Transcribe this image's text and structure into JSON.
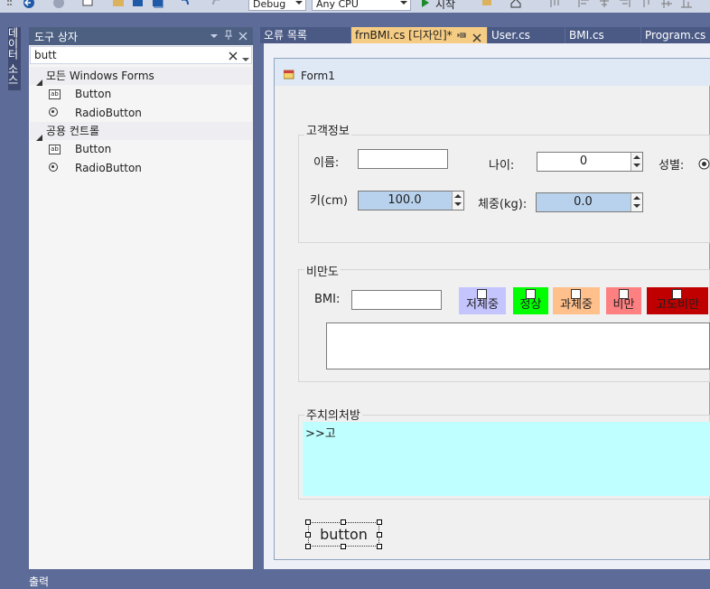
{
  "toolbar": {
    "config_value": "Debug",
    "platform_value": "Any CPU",
    "start_label": "시작"
  },
  "side_strip": {
    "data_source_label": "데이터 소스"
  },
  "toolbox": {
    "title": "도구 상자",
    "search_value": "butt",
    "groups": [
      {
        "label": "모든 Windows Forms",
        "items": [
          {
            "label": "Button",
            "icon": "button-icon"
          },
          {
            "label": "RadioButton",
            "icon": "radio-icon"
          }
        ]
      },
      {
        "label": "공용 컨트롤",
        "items": [
          {
            "label": "Button",
            "icon": "button-icon"
          },
          {
            "label": "RadioButton",
            "icon": "radio-icon"
          }
        ]
      }
    ]
  },
  "tabs": {
    "error_list": "오류 목록",
    "frnbmi": "frnBMI.cs [디자인]*",
    "user": "User.cs",
    "bmi": "BMI.cs",
    "program": "Program.cs"
  },
  "form": {
    "title": "Form1",
    "customer": {
      "group_title": "고객정보",
      "name_label": "이름:",
      "age_label": "나이:",
      "age_value": "0",
      "gender_label": "성별:",
      "height_label": "키(cm)",
      "height_value": "100.0",
      "weight_label": "체중(kg):",
      "weight_value": "0.0"
    },
    "obesity": {
      "group_title": "비만도",
      "bmi_label": "BMI:",
      "categories": [
        {
          "label": "저체중",
          "color": "#c4c4ff"
        },
        {
          "label": "정상",
          "color": "#00ff00"
        },
        {
          "label": "과체중",
          "color": "#ffc08c"
        },
        {
          "label": "비만",
          "color": "#ff8080"
        },
        {
          "label": "고도비만",
          "color": "#c00000"
        }
      ]
    },
    "prescription": {
      "group_title": "주치의처방",
      "text": ">>고",
      "bg_color": "#c0ffff"
    },
    "button_label": "button"
  },
  "bottom": {
    "output_label": "출력"
  }
}
